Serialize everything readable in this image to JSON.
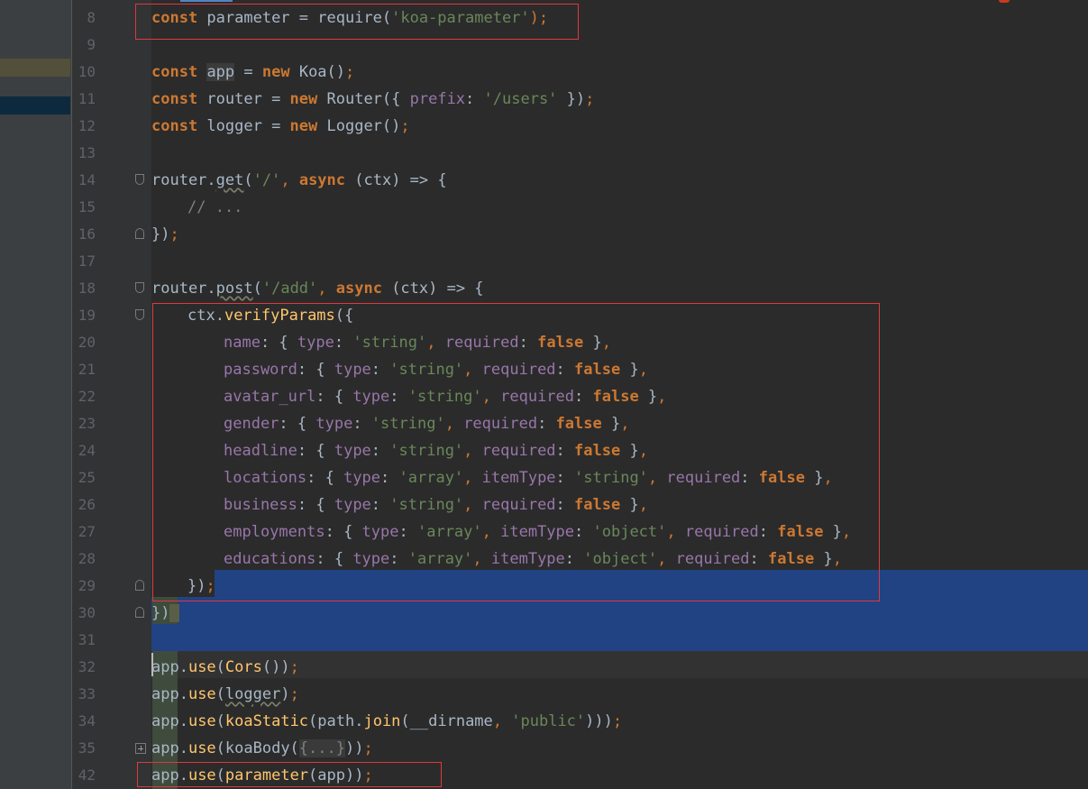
{
  "editor": {
    "lines": [
      {
        "num": "8",
        "indent": 0,
        "tokens": [
          {
            "t": "const",
            "c": "kw"
          },
          {
            "t": " parameter = require(",
            "c": "plain"
          },
          {
            "t": "'koa-parameter'",
            "c": "str"
          },
          {
            "t": ");",
            "c": "pun"
          }
        ]
      },
      {
        "num": "9",
        "indent": 0,
        "tokens": []
      },
      {
        "num": "10",
        "indent": 0,
        "tokens": [
          {
            "t": "const",
            "c": "kw"
          },
          {
            "t": " ",
            "c": "plain"
          },
          {
            "t": "app",
            "c": "hl-app"
          },
          {
            "t": " = ",
            "c": "plain"
          },
          {
            "t": "new",
            "c": "kw"
          },
          {
            "t": " Koa()",
            "c": "plain"
          },
          {
            "t": ";",
            "c": "pun"
          }
        ]
      },
      {
        "num": "11",
        "indent": 0,
        "tokens": [
          {
            "t": "const",
            "c": "kw"
          },
          {
            "t": " router = ",
            "c": "plain"
          },
          {
            "t": "new",
            "c": "kw"
          },
          {
            "t": " Router({ ",
            "c": "plain"
          },
          {
            "t": "prefix",
            "c": "prop"
          },
          {
            "t": ": ",
            "c": "plain"
          },
          {
            "t": "'/users'",
            "c": "str"
          },
          {
            "t": " })",
            "c": "plain"
          },
          {
            "t": ";",
            "c": "pun"
          }
        ]
      },
      {
        "num": "12",
        "indent": 0,
        "tokens": [
          {
            "t": "const",
            "c": "kw"
          },
          {
            "t": " logger = ",
            "c": "plain"
          },
          {
            "t": "new",
            "c": "kw"
          },
          {
            "t": " Logger()",
            "c": "plain"
          },
          {
            "t": ";",
            "c": "pun"
          }
        ]
      },
      {
        "num": "13",
        "indent": 0,
        "tokens": []
      },
      {
        "num": "14",
        "indent": 0,
        "fold": "open",
        "tokens": [
          {
            "t": "router.",
            "c": "plain"
          },
          {
            "t": "get",
            "c": "wavy"
          },
          {
            "t": "(",
            "c": "plain"
          },
          {
            "t": "'/'",
            "c": "str"
          },
          {
            "t": ", ",
            "c": "pun"
          },
          {
            "t": "async",
            "c": "kw"
          },
          {
            "t": " (ctx) => {",
            "c": "plain"
          }
        ]
      },
      {
        "num": "15",
        "indent": 1,
        "tokens": [
          {
            "t": "// ...",
            "c": "cmt"
          }
        ]
      },
      {
        "num": "16",
        "indent": 0,
        "fold": "close",
        "tokens": [
          {
            "t": "})",
            "c": "plain"
          },
          {
            "t": ";",
            "c": "pun"
          }
        ]
      },
      {
        "num": "17",
        "indent": 0,
        "tokens": []
      },
      {
        "num": "18",
        "indent": 0,
        "fold": "open",
        "tokens": [
          {
            "t": "router.",
            "c": "plain"
          },
          {
            "t": "post",
            "c": "wavy"
          },
          {
            "t": "(",
            "c": "plain"
          },
          {
            "t": "'/add'",
            "c": "str"
          },
          {
            "t": ", ",
            "c": "pun"
          },
          {
            "t": "async",
            "c": "kw"
          },
          {
            "t": " (ctx) => {",
            "c": "plain"
          }
        ]
      },
      {
        "num": "19",
        "indent": 1,
        "fold": "open",
        "tokens": [
          {
            "t": "ctx.",
            "c": "plain"
          },
          {
            "t": "verifyParams",
            "c": "fn"
          },
          {
            "t": "({",
            "c": "plain"
          }
        ]
      },
      {
        "num": "20",
        "indent": 2,
        "tokens": [
          {
            "t": "name",
            "c": "prop"
          },
          {
            "t": ": { ",
            "c": "plain"
          },
          {
            "t": "type",
            "c": "prop"
          },
          {
            "t": ": ",
            "c": "plain"
          },
          {
            "t": "'string'",
            "c": "str"
          },
          {
            "t": ", ",
            "c": "pun"
          },
          {
            "t": "required",
            "c": "prop"
          },
          {
            "t": ": ",
            "c": "plain"
          },
          {
            "t": "false",
            "c": "kw"
          },
          {
            "t": " }",
            "c": "plain"
          },
          {
            "t": ",",
            "c": "pun"
          }
        ]
      },
      {
        "num": "21",
        "indent": 2,
        "tokens": [
          {
            "t": "password",
            "c": "prop"
          },
          {
            "t": ": { ",
            "c": "plain"
          },
          {
            "t": "type",
            "c": "prop"
          },
          {
            "t": ": ",
            "c": "plain"
          },
          {
            "t": "'string'",
            "c": "str"
          },
          {
            "t": ", ",
            "c": "pun"
          },
          {
            "t": "required",
            "c": "prop"
          },
          {
            "t": ": ",
            "c": "plain"
          },
          {
            "t": "false",
            "c": "kw"
          },
          {
            "t": " }",
            "c": "plain"
          },
          {
            "t": ",",
            "c": "pun"
          }
        ]
      },
      {
        "num": "22",
        "indent": 2,
        "tokens": [
          {
            "t": "avatar_url",
            "c": "prop"
          },
          {
            "t": ": { ",
            "c": "plain"
          },
          {
            "t": "type",
            "c": "prop"
          },
          {
            "t": ": ",
            "c": "plain"
          },
          {
            "t": "'string'",
            "c": "str"
          },
          {
            "t": ", ",
            "c": "pun"
          },
          {
            "t": "required",
            "c": "prop"
          },
          {
            "t": ": ",
            "c": "plain"
          },
          {
            "t": "false",
            "c": "kw"
          },
          {
            "t": " }",
            "c": "plain"
          },
          {
            "t": ",",
            "c": "pun"
          }
        ]
      },
      {
        "num": "23",
        "indent": 2,
        "tokens": [
          {
            "t": "gender",
            "c": "prop"
          },
          {
            "t": ": { ",
            "c": "plain"
          },
          {
            "t": "type",
            "c": "prop"
          },
          {
            "t": ": ",
            "c": "plain"
          },
          {
            "t": "'string'",
            "c": "str"
          },
          {
            "t": ", ",
            "c": "pun"
          },
          {
            "t": "required",
            "c": "prop"
          },
          {
            "t": ": ",
            "c": "plain"
          },
          {
            "t": "false",
            "c": "kw"
          },
          {
            "t": " }",
            "c": "plain"
          },
          {
            "t": ",",
            "c": "pun"
          }
        ]
      },
      {
        "num": "24",
        "indent": 2,
        "tokens": [
          {
            "t": "headline",
            "c": "prop"
          },
          {
            "t": ": { ",
            "c": "plain"
          },
          {
            "t": "type",
            "c": "prop"
          },
          {
            "t": ": ",
            "c": "plain"
          },
          {
            "t": "'string'",
            "c": "str"
          },
          {
            "t": ", ",
            "c": "pun"
          },
          {
            "t": "required",
            "c": "prop"
          },
          {
            "t": ": ",
            "c": "plain"
          },
          {
            "t": "false",
            "c": "kw"
          },
          {
            "t": " }",
            "c": "plain"
          },
          {
            "t": ",",
            "c": "pun"
          }
        ]
      },
      {
        "num": "25",
        "indent": 2,
        "tokens": [
          {
            "t": "locations",
            "c": "prop"
          },
          {
            "t": ": { ",
            "c": "plain"
          },
          {
            "t": "type",
            "c": "prop"
          },
          {
            "t": ": ",
            "c": "plain"
          },
          {
            "t": "'array'",
            "c": "str"
          },
          {
            "t": ", ",
            "c": "pun"
          },
          {
            "t": "itemType",
            "c": "prop"
          },
          {
            "t": ": ",
            "c": "plain"
          },
          {
            "t": "'string'",
            "c": "str"
          },
          {
            "t": ", ",
            "c": "pun"
          },
          {
            "t": "required",
            "c": "prop"
          },
          {
            "t": ": ",
            "c": "plain"
          },
          {
            "t": "false",
            "c": "kw"
          },
          {
            "t": " }",
            "c": "plain"
          },
          {
            "t": ",",
            "c": "pun"
          }
        ]
      },
      {
        "num": "26",
        "indent": 2,
        "tokens": [
          {
            "t": "business",
            "c": "prop"
          },
          {
            "t": ": { ",
            "c": "plain"
          },
          {
            "t": "type",
            "c": "prop"
          },
          {
            "t": ": ",
            "c": "plain"
          },
          {
            "t": "'string'",
            "c": "str"
          },
          {
            "t": ", ",
            "c": "pun"
          },
          {
            "t": "required",
            "c": "prop"
          },
          {
            "t": ": ",
            "c": "plain"
          },
          {
            "t": "false",
            "c": "kw"
          },
          {
            "t": " }",
            "c": "plain"
          },
          {
            "t": ",",
            "c": "pun"
          }
        ]
      },
      {
        "num": "27",
        "indent": 2,
        "tokens": [
          {
            "t": "employments",
            "c": "prop"
          },
          {
            "t": ": { ",
            "c": "plain"
          },
          {
            "t": "type",
            "c": "prop"
          },
          {
            "t": ": ",
            "c": "plain"
          },
          {
            "t": "'array'",
            "c": "str"
          },
          {
            "t": ", ",
            "c": "pun"
          },
          {
            "t": "itemType",
            "c": "prop"
          },
          {
            "t": ": ",
            "c": "plain"
          },
          {
            "t": "'object'",
            "c": "str"
          },
          {
            "t": ", ",
            "c": "pun"
          },
          {
            "t": "required",
            "c": "prop"
          },
          {
            "t": ": ",
            "c": "plain"
          },
          {
            "t": "false",
            "c": "kw"
          },
          {
            "t": " }",
            "c": "plain"
          },
          {
            "t": ",",
            "c": "pun"
          }
        ]
      },
      {
        "num": "28",
        "indent": 2,
        "tokens": [
          {
            "t": "educations",
            "c": "prop"
          },
          {
            "t": ": { ",
            "c": "plain"
          },
          {
            "t": "type",
            "c": "prop"
          },
          {
            "t": ": ",
            "c": "plain"
          },
          {
            "t": "'array'",
            "c": "str"
          },
          {
            "t": ", ",
            "c": "pun"
          },
          {
            "t": "itemType",
            "c": "prop"
          },
          {
            "t": ": ",
            "c": "plain"
          },
          {
            "t": "'object'",
            "c": "str"
          },
          {
            "t": ", ",
            "c": "pun"
          },
          {
            "t": "required",
            "c": "prop"
          },
          {
            "t": ": ",
            "c": "plain"
          },
          {
            "t": "false",
            "c": "kw"
          },
          {
            "t": " }",
            "c": "plain"
          },
          {
            "t": ",",
            "c": "pun"
          }
        ]
      },
      {
        "num": "29",
        "indent": 1,
        "fold": "close",
        "tokens": [
          {
            "t": "})",
            "c": "plain"
          },
          {
            "t": ";",
            "c": "pun"
          }
        ]
      },
      {
        "num": "30",
        "indent": 0,
        "fold": "close",
        "tokens": [
          {
            "t": "})",
            "c": "plain"
          },
          {
            "t": " ",
            "c": "brmatch"
          }
        ]
      },
      {
        "num": "31",
        "indent": 0,
        "tokens": []
      },
      {
        "num": "32",
        "indent": 0,
        "tokens": [
          {
            "t": "app.",
            "c": "plain"
          },
          {
            "t": "use",
            "c": "fn"
          },
          {
            "t": "(",
            "c": "plain"
          },
          {
            "t": "Cors",
            "c": "fn"
          },
          {
            "t": "())",
            "c": "plain"
          },
          {
            "t": ";",
            "c": "pun"
          }
        ]
      },
      {
        "num": "33",
        "indent": 0,
        "tokens": [
          {
            "t": "app.",
            "c": "plain"
          },
          {
            "t": "use",
            "c": "fn"
          },
          {
            "t": "(",
            "c": "plain"
          },
          {
            "t": "logger",
            "c": "wavy"
          },
          {
            "t": ")",
            "c": "plain"
          },
          {
            "t": ";",
            "c": "pun"
          }
        ]
      },
      {
        "num": "34",
        "indent": 0,
        "tokens": [
          {
            "t": "app.",
            "c": "plain"
          },
          {
            "t": "use",
            "c": "fn"
          },
          {
            "t": "(",
            "c": "plain"
          },
          {
            "t": "koaStatic",
            "c": "fn"
          },
          {
            "t": "(path.",
            "c": "plain"
          },
          {
            "t": "join",
            "c": "fn"
          },
          {
            "t": "(__dirname",
            "c": "plain"
          },
          {
            "t": ", ",
            "c": "pun"
          },
          {
            "t": "'public'",
            "c": "str"
          },
          {
            "t": ")))",
            "c": "plain"
          },
          {
            "t": ";",
            "c": "pun"
          }
        ]
      },
      {
        "num": "35",
        "indent": 0,
        "fold": "plus",
        "tokens": [
          {
            "t": "app.",
            "c": "plain"
          },
          {
            "t": "use",
            "c": "fn"
          },
          {
            "t": "(koaBody(",
            "c": "plain"
          },
          {
            "t": "{...}",
            "c": "collapsed"
          },
          {
            "t": "))",
            "c": "plain"
          },
          {
            "t": ";",
            "c": "pun"
          }
        ]
      },
      {
        "num": "42",
        "indent": 0,
        "tokens": [
          {
            "t": "app.",
            "c": "plain"
          },
          {
            "t": "use",
            "c": "fn"
          },
          {
            "t": "(",
            "c": "plain"
          },
          {
            "t": "parameter",
            "c": "fn"
          },
          {
            "t": "(app))",
            "c": "plain"
          },
          {
            "t": ";",
            "c": "pun"
          }
        ]
      }
    ]
  }
}
